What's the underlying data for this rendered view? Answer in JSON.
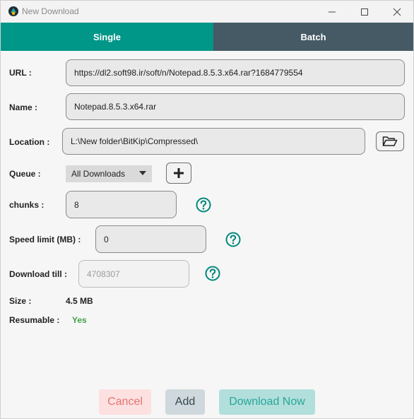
{
  "window": {
    "title": "New Download",
    "controls": {
      "minimize": "minimize-icon",
      "maximize": "maximize-icon",
      "close": "close-icon"
    }
  },
  "tabs": [
    {
      "label": "Single",
      "active": true
    },
    {
      "label": "Batch",
      "active": false
    }
  ],
  "form": {
    "url_label": "URL :",
    "url_value": "https://dl2.soft98.ir/soft/n/Notepad.8.5.3.x64.rar?1684779554",
    "name_label": "Name :",
    "name_value": "Notepad.8.5.3.x64.rar",
    "location_label": "Location :",
    "location_value": "L:\\New folder\\BitKip\\Compressed\\",
    "queue_label": "Queue :",
    "queue_value": "All Downloads",
    "chunks_label": "chunks :",
    "chunks_value": "8",
    "speed_label": "Speed limit (MB) :",
    "speed_value": "0",
    "till_label": "Download till :",
    "till_placeholder": "4708307",
    "size_label": "Size :",
    "size_value": "4.5 MB",
    "resumable_label": "Resumable :",
    "resumable_value": "Yes"
  },
  "buttons": {
    "cancel": "Cancel",
    "add": "Add",
    "download_now": "Download Now"
  },
  "colors": {
    "accent": "#009688",
    "tab_inactive": "#455a64",
    "help": "#00897b",
    "success": "#43a047"
  }
}
